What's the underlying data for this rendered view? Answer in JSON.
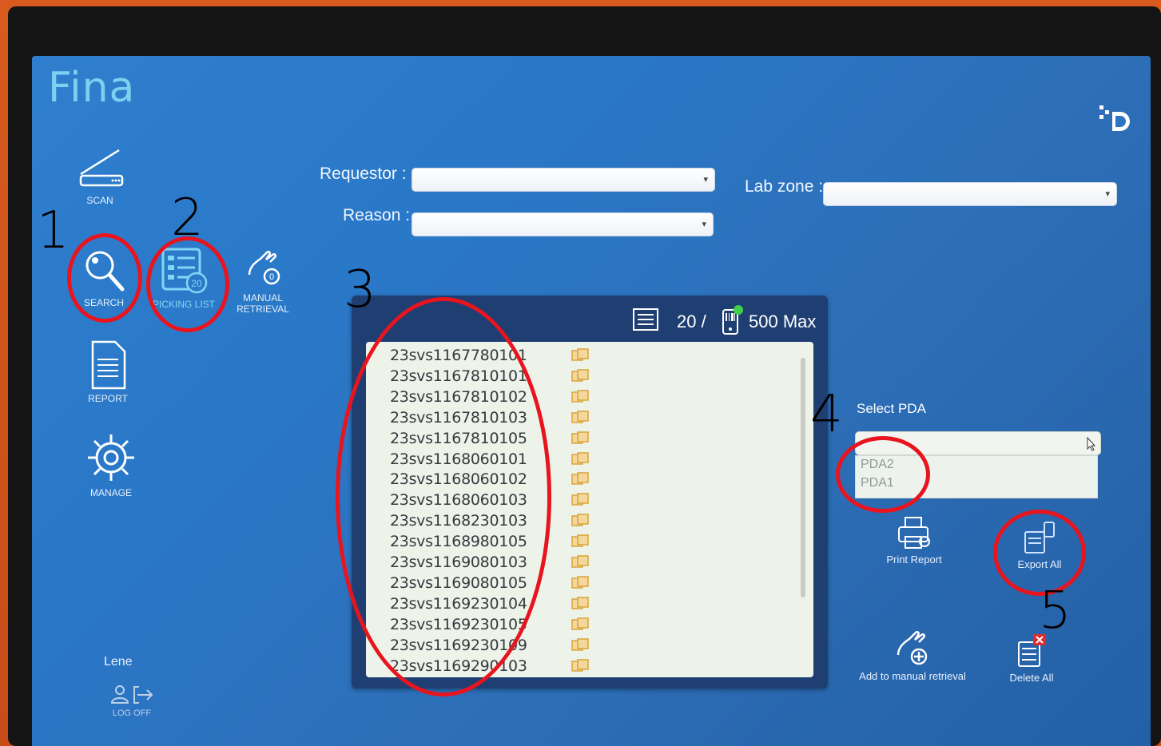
{
  "app": {
    "title": "Fina"
  },
  "nav": {
    "scan": "SCAN",
    "search": "SEARCH",
    "picking_list": "PICKING LIST",
    "picking_badge": "20",
    "manual_retrieval_1": "MANUAL",
    "manual_retrieval_2": "RETRIEVAL",
    "manual_badge": "0",
    "report": "REPORT",
    "manage": "MANAGE"
  },
  "form": {
    "requestor_label": "Requestor :",
    "requestor_value": "",
    "reason_label": "Reason :",
    "reason_value": "",
    "labzone_label": "Lab zone :",
    "labzone_value": ""
  },
  "list": {
    "count": "20 /",
    "max": "500 Max",
    "items": [
      "23svs1167780101",
      "23svs1167810101",
      "23svs1167810102",
      "23svs1167810103",
      "23svs1167810105",
      "23svs1168060101",
      "23svs1168060102",
      "23svs1168060103",
      "23svs1168230103",
      "23svs1168980105",
      "23svs1169080103",
      "23svs1169080105",
      "23svs1169230104",
      "23svs1169230105",
      "23svs1169230109",
      "23svs1169290103"
    ]
  },
  "pda": {
    "label": "Select PDA",
    "selected": "",
    "options": [
      "PDA2",
      "PDA1"
    ]
  },
  "actions": {
    "print_report": "Print Report",
    "export_all": "Export All",
    "add_manual": "Add to manual retrieval",
    "delete_all": "Delete All"
  },
  "user": {
    "name": "Lene",
    "logoff": "LOG OFF"
  },
  "annotations": [
    "1",
    "2",
    "3",
    "4",
    "5"
  ],
  "colors": {
    "screen_bg": "#2f7fce",
    "panel_bg": "#1f3f72",
    "accent": "#7fd8f5",
    "annotation": "#e8141e"
  }
}
